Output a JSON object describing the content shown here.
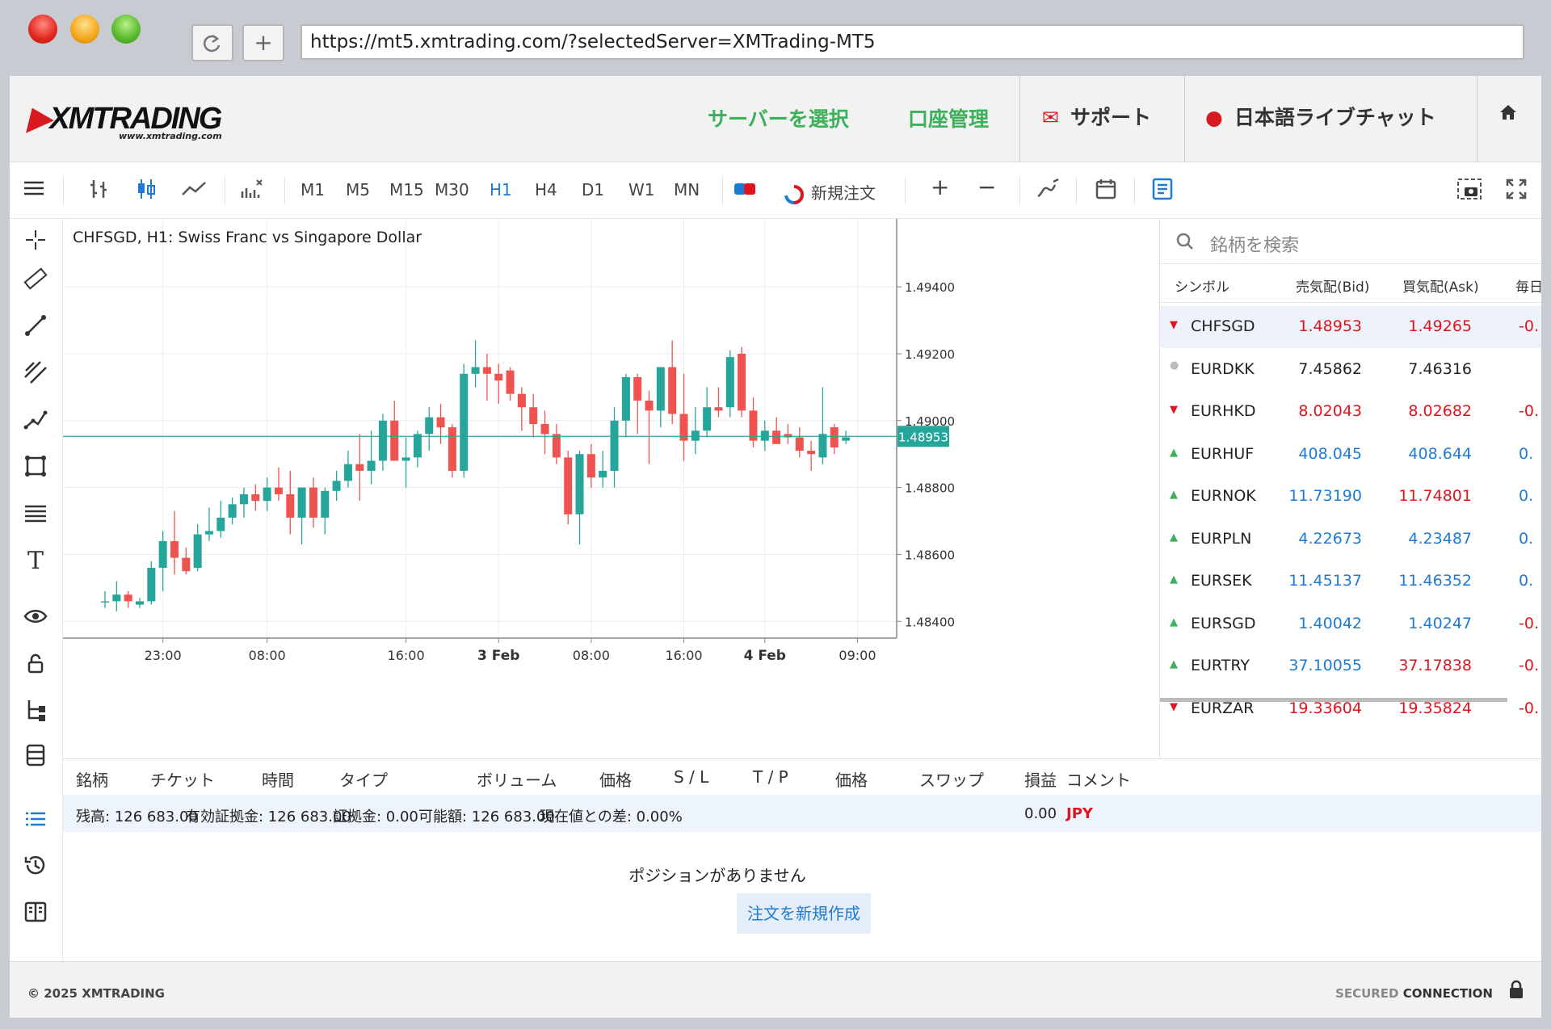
{
  "browser": {
    "url": "https://mt5.xmtrading.com/?selectedServer=XMTrading-MT5",
    "reload_icon": "reload-icon",
    "new_tab_icon": "plus-icon"
  },
  "header": {
    "logo": "XMTRADING",
    "logo_sub": "www.xmtrading.com",
    "select_server": "サーバーを選択",
    "account_management": "口座管理",
    "support": "サポート",
    "live_chat": "日本語ライブチャット",
    "home_icon": "home-icon"
  },
  "toolbar": {
    "timeframes": [
      "M1",
      "M5",
      "M15",
      "M30",
      "H1",
      "H4",
      "D1",
      "W1",
      "MN"
    ],
    "active_timeframe": "H1",
    "new_order": "新規注文",
    "zoom_in": "+",
    "zoom_out": "−"
  },
  "chart": {
    "title": "CHFSGD, H1: Swiss Franc vs Singapore Dollar",
    "price_label": "1.48953",
    "colors": {
      "up": "#26a69a",
      "down": "#ef5350",
      "price_line": "#26a69a"
    }
  },
  "chart_data": {
    "type": "candlestick",
    "symbol": "CHFSGD",
    "timeframe": "H1",
    "title": "CHFSGD, H1: Swiss Franc vs Singapore Dollar",
    "x_ticks": [
      "23:00",
      "08:00",
      "16:00",
      "3 Feb",
      "08:00",
      "16:00",
      "4 Feb",
      "09:00"
    ],
    "y_ticks": [
      1.494,
      1.492,
      1.49,
      1.488,
      1.486,
      1.484
    ],
    "y_tick_labels": [
      "1.49400",
      "1.49200",
      "1.49000",
      "1.48800",
      "1.48600",
      "1.48400"
    ],
    "ylim": [
      1.4835,
      1.4955
    ],
    "last_price": 1.48953,
    "candles": [
      [
        1.4846,
        1.4849,
        1.4844,
        1.4846
      ],
      [
        1.4846,
        1.4852,
        1.4843,
        1.4848
      ],
      [
        1.4848,
        1.4849,
        1.4844,
        1.4846
      ],
      [
        1.4845,
        1.4847,
        1.4844,
        1.4846
      ],
      [
        1.4846,
        1.4858,
        1.4845,
        1.4856
      ],
      [
        1.4856,
        1.4867,
        1.4849,
        1.4864
      ],
      [
        1.4864,
        1.4873,
        1.4854,
        1.4859
      ],
      [
        1.4859,
        1.4862,
        1.4854,
        1.4855
      ],
      [
        1.4856,
        1.4869,
        1.4855,
        1.4866
      ],
      [
        1.4866,
        1.4874,
        1.4864,
        1.4867
      ],
      [
        1.4867,
        1.4876,
        1.4865,
        1.4871
      ],
      [
        1.4871,
        1.4877,
        1.4869,
        1.4875
      ],
      [
        1.4875,
        1.488,
        1.4871,
        1.4878
      ],
      [
        1.4878,
        1.4881,
        1.4873,
        1.4876
      ],
      [
        1.4876,
        1.4883,
        1.4873,
        1.488
      ],
      [
        1.488,
        1.4886,
        1.4876,
        1.4878
      ],
      [
        1.4878,
        1.4885,
        1.4866,
        1.4871
      ],
      [
        1.4871,
        1.488,
        1.4863,
        1.488
      ],
      [
        1.488,
        1.4883,
        1.4868,
        1.4871
      ],
      [
        1.4871,
        1.488,
        1.4866,
        1.4879
      ],
      [
        1.4879,
        1.4885,
        1.4876,
        1.4882
      ],
      [
        1.4882,
        1.4891,
        1.488,
        1.4887
      ],
      [
        1.4887,
        1.4896,
        1.4876,
        1.4885
      ],
      [
        1.4885,
        1.4897,
        1.4881,
        1.4888
      ],
      [
        1.4888,
        1.4902,
        1.4885,
        1.49
      ],
      [
        1.49,
        1.4906,
        1.4889,
        1.4888
      ],
      [
        1.4888,
        1.4895,
        1.488,
        1.4889
      ],
      [
        1.4889,
        1.4897,
        1.4886,
        1.4896
      ],
      [
        1.4896,
        1.4904,
        1.4891,
        1.4901
      ],
      [
        1.4901,
        1.4905,
        1.4893,
        1.4898
      ],
      [
        1.4898,
        1.4899,
        1.4883,
        1.4885
      ],
      [
        1.4885,
        1.4917,
        1.4883,
        1.4914
      ],
      [
        1.4914,
        1.4924,
        1.491,
        1.4916
      ],
      [
        1.4916,
        1.492,
        1.4906,
        1.4914
      ],
      [
        1.4914,
        1.4917,
        1.4905,
        1.4912
      ],
      [
        1.4915,
        1.4916,
        1.4906,
        1.4908
      ],
      [
        1.4908,
        1.491,
        1.4897,
        1.4904
      ],
      [
        1.4904,
        1.4908,
        1.4895,
        1.4899
      ],
      [
        1.4899,
        1.4903,
        1.489,
        1.4896
      ],
      [
        1.4896,
        1.4899,
        1.4887,
        1.4889
      ],
      [
        1.4889,
        1.4891,
        1.4869,
        1.4872
      ],
      [
        1.4872,
        1.4891,
        1.4863,
        1.489
      ],
      [
        1.489,
        1.4893,
        1.488,
        1.4883
      ],
      [
        1.4883,
        1.4891,
        1.488,
        1.4885
      ],
      [
        1.4885,
        1.4904,
        1.488,
        1.49
      ],
      [
        1.49,
        1.4914,
        1.4895,
        1.4913
      ],
      [
        1.4913,
        1.4914,
        1.4896,
        1.4906
      ],
      [
        1.4906,
        1.4909,
        1.4887,
        1.4903
      ],
      [
        1.4903,
        1.4914,
        1.4898,
        1.4916
      ],
      [
        1.4916,
        1.4924,
        1.4899,
        1.4902
      ],
      [
        1.4902,
        1.4914,
        1.4888,
        1.4894
      ],
      [
        1.4894,
        1.4904,
        1.489,
        1.4897
      ],
      [
        1.4897,
        1.491,
        1.4895,
        1.4904
      ],
      [
        1.4904,
        1.491,
        1.4901,
        1.4903
      ],
      [
        1.4904,
        1.4921,
        1.4901,
        1.4919
      ],
      [
        1.492,
        1.4922,
        1.4901,
        1.4903
      ],
      [
        1.4903,
        1.4907,
        1.4892,
        1.4894
      ],
      [
        1.4894,
        1.49,
        1.4891,
        1.4897
      ],
      [
        1.4897,
        1.4901,
        1.4893,
        1.4893
      ],
      [
        1.4896,
        1.4899,
        1.4893,
        1.4895
      ],
      [
        1.4895,
        1.4898,
        1.4889,
        1.4891
      ],
      [
        1.4891,
        1.4894,
        1.4885,
        1.489
      ],
      [
        1.4889,
        1.491,
        1.4887,
        1.4896
      ],
      [
        1.4898,
        1.4899,
        1.489,
        1.4892
      ],
      [
        1.4894,
        1.4897,
        1.4893,
        1.4895
      ]
    ]
  },
  "market_watch": {
    "search_placeholder": "銘柄を検索",
    "columns": [
      "シンボル",
      "売気配(Bid)",
      "買気配(Ask)",
      "毎日の"
    ],
    "rows": [
      {
        "symbol": "CHFSGD",
        "bid": "1.48953",
        "ask": "1.49265",
        "chg": "-0.",
        "dir": "dn"
      },
      {
        "symbol": "EURDKK",
        "bid": "7.45862",
        "ask": "7.46316",
        "chg": "",
        "dir": "neu"
      },
      {
        "symbol": "EURHKD",
        "bid": "8.02043",
        "ask": "8.02682",
        "chg": "-0.",
        "dir": "dn"
      },
      {
        "symbol": "EURHUF",
        "bid": "408.045",
        "ask": "408.644",
        "chg": "0.",
        "dir": "up"
      },
      {
        "symbol": "EURNOK",
        "bid": "11.73190",
        "ask": "11.74801",
        "chg": "0.",
        "dir": "mixed"
      },
      {
        "symbol": "EURPLN",
        "bid": "4.22673",
        "ask": "4.23487",
        "chg": "0.",
        "dir": "up"
      },
      {
        "symbol": "EURSEK",
        "bid": "11.45137",
        "ask": "11.46352",
        "chg": "0.",
        "dir": "up"
      },
      {
        "symbol": "EURSGD",
        "bid": "1.40042",
        "ask": "1.40247",
        "chg": "-0.",
        "dir": "up"
      },
      {
        "symbol": "EURTRY",
        "bid": "37.10055",
        "ask": "37.17838",
        "chg": "-0.",
        "dir": "mixed"
      },
      {
        "symbol": "EURZAR",
        "bid": "19.33604",
        "ask": "19.35824",
        "chg": "-0.",
        "dir": "dn"
      }
    ]
  },
  "positions": {
    "columns": [
      "銘柄",
      "チケット",
      "時間",
      "タイプ",
      "ボリューム",
      "価格",
      "S / L",
      "T / P",
      "価格",
      "スワップ",
      "損益",
      "コメント"
    ],
    "account": {
      "balance": "残高: 126 683.00",
      "equity": "有効証拠金: 126 683.00",
      "margin": "証拠金: 0.00",
      "free": "可能額: 126 683.00",
      "diff": "現在値との差: 0.00%",
      "pl": "0.00",
      "currency": "JPY"
    },
    "empty_text": "ポジションがありません",
    "new_order_button": "注文を新規作成"
  },
  "footer": {
    "copyright": "© 2025 XMTRADING",
    "secured": "SECURED",
    "connection": "CONNECTION"
  }
}
